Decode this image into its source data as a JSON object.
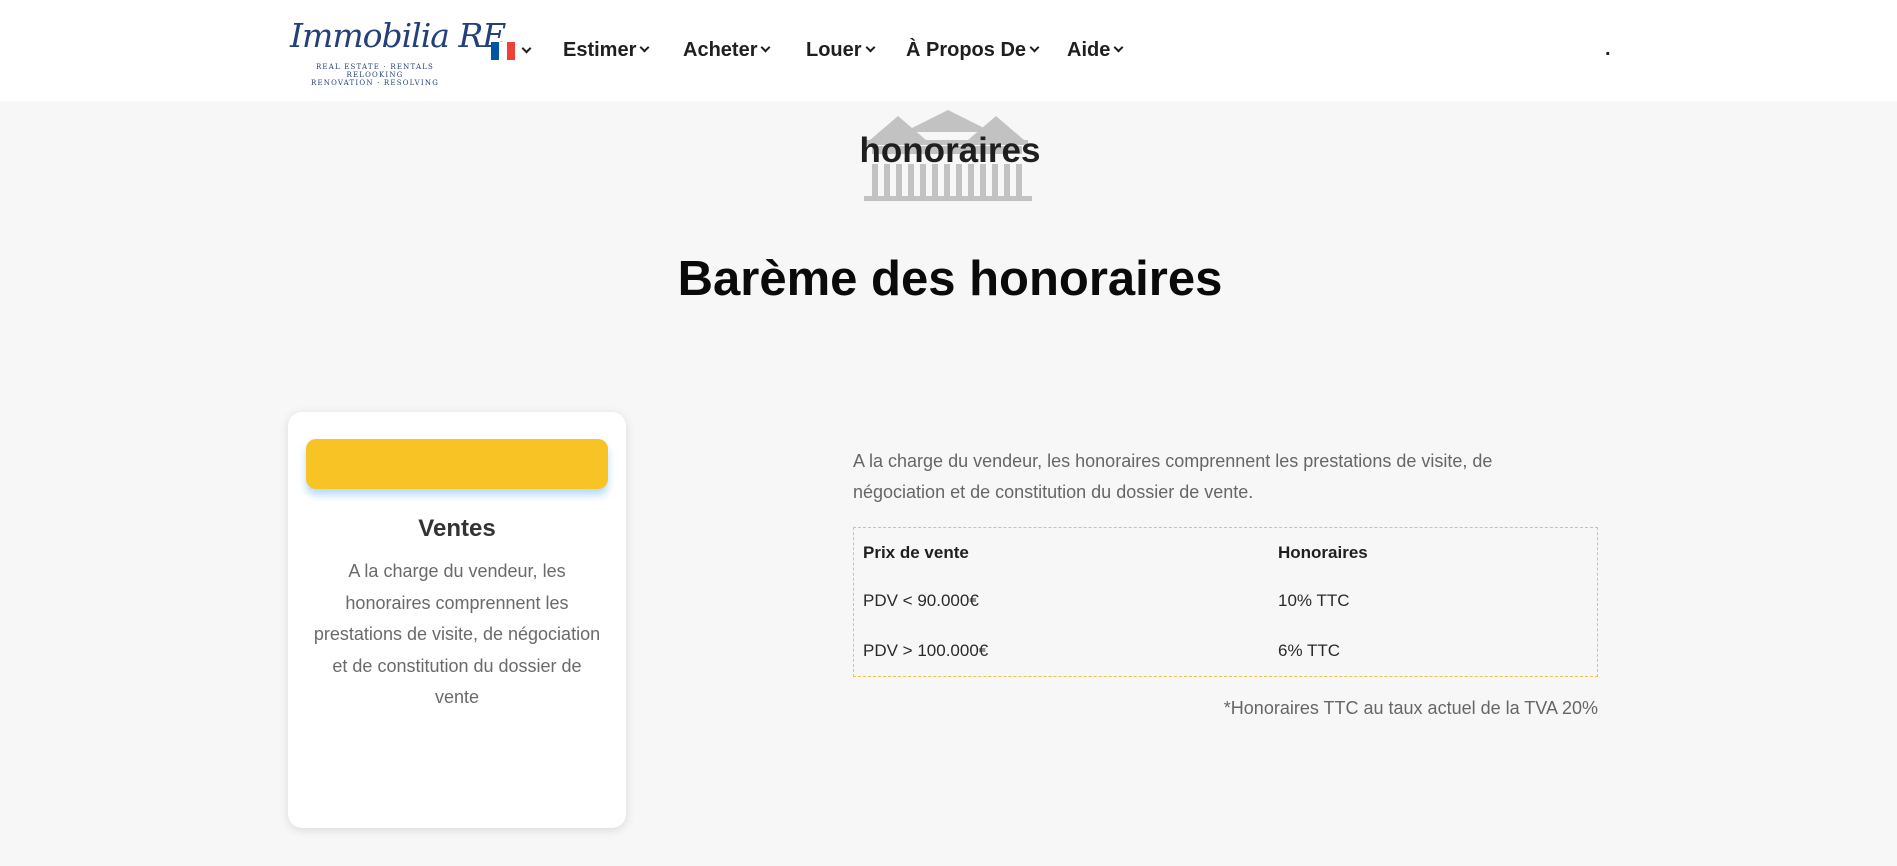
{
  "header": {
    "logo": {
      "script": "Immobilia RE",
      "tagline_1": "REAL ESTATE · RENTALS",
      "tagline_2": "RELOOKING",
      "tagline_3": "RENOVATION · RESOLVING"
    },
    "language": {
      "flag_icon": "french-flag-icon",
      "colors": [
        "#0055a4",
        "#ffffff",
        "#ef4135"
      ]
    },
    "nav": [
      {
        "label": "Estimer"
      },
      {
        "label": "Acheter"
      },
      {
        "label": "Louer"
      },
      {
        "label": "À Propos De"
      },
      {
        "label": "Aide"
      }
    ],
    "trailing_text": "."
  },
  "banner": {
    "icon": "house-icon",
    "title": "honoraires"
  },
  "main": {
    "title": "Barème des honoraires"
  },
  "card": {
    "button_color": "#f8c324",
    "title": "Ventes",
    "text": "A la charge du vendeur, les honoraires comprennent les prestations de visite, de négociation et de constitution du dossier de vente"
  },
  "fees": {
    "intro": "A la charge du vendeur, les honoraires comprennent les prestations de visite, de négociation et de constitution du dossier de vente.",
    "columns": [
      "Prix de vente",
      "Honoraires"
    ],
    "rows": [
      [
        "PDV < 90.000€",
        "10% TTC"
      ],
      [
        "PDV > 100.000€",
        "6% TTC"
      ]
    ],
    "note": "*Honoraires TTC au taux actuel de la TVA 20%"
  },
  "colors": {
    "accent": "#f8c324",
    "background": "#f7f7f7",
    "brand_blue": "#23407a"
  }
}
